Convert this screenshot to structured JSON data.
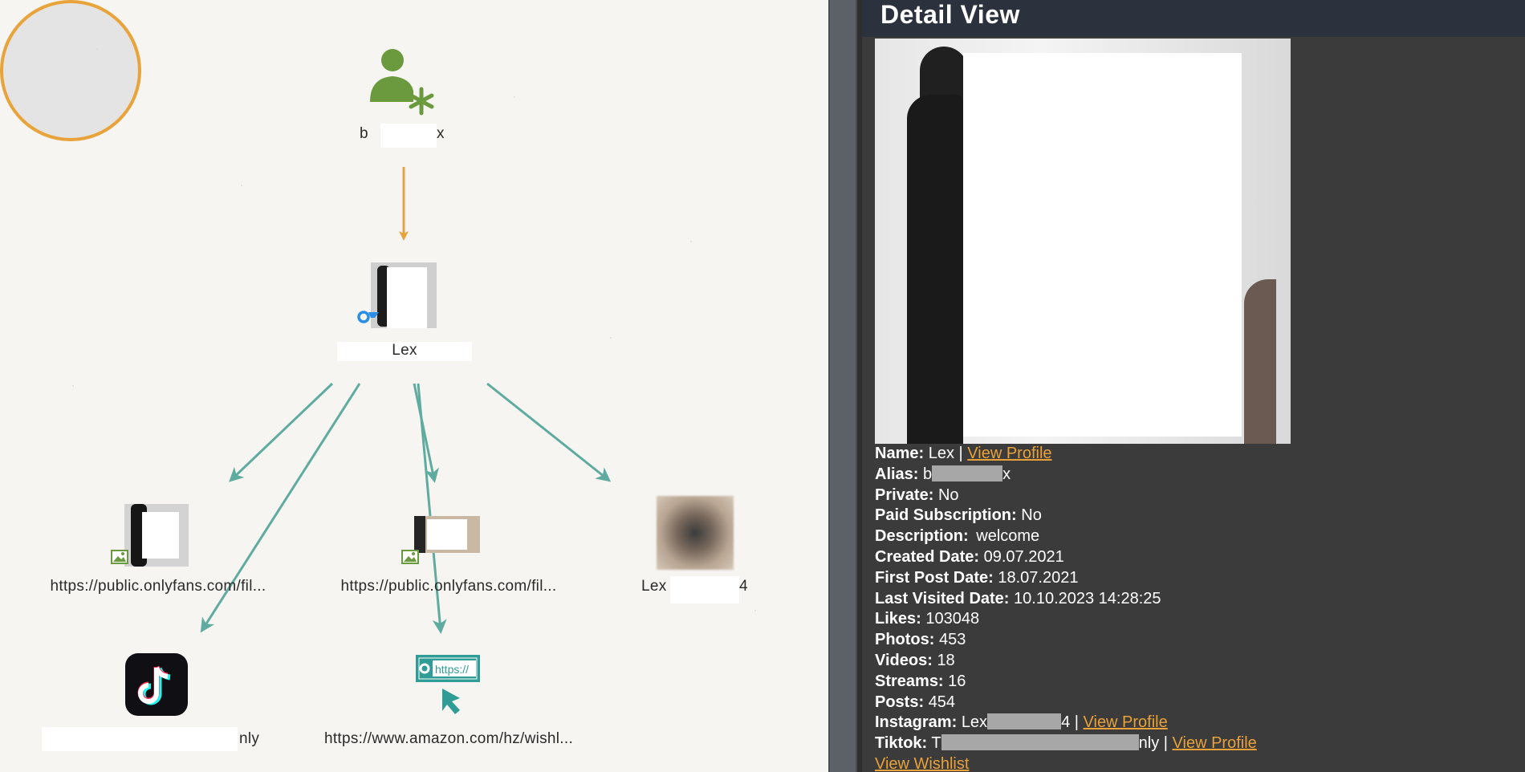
{
  "graph": {
    "alias_node": {
      "icon": "user-add-icon",
      "label_start": "b",
      "label_end": "x",
      "color": "#6b9a3e"
    },
    "center_node": {
      "label": "Lex",
      "badge_icon": "onlyfans-icon",
      "ring_color": "#e8a33a"
    },
    "image_nodes": [
      {
        "label": "https://public.onlyfans.com/fil..."
      },
      {
        "label": "https://public.onlyfans.com/fil..."
      }
    ],
    "instagram_node": {
      "label_start": "Lex",
      "label_end": "4"
    },
    "tiktok_node": {
      "label_end": "nly"
    },
    "wishlist_node": {
      "label": "https://www.amazon.com/hz/wishl...",
      "icon_text": "https://"
    },
    "edge_colors": {
      "primary": "#e8a33a",
      "secondary": "#5fab9f"
    }
  },
  "detail": {
    "title": "Detail View",
    "fields": {
      "name": {
        "key": "Name:",
        "value": "Lex",
        "sep": "|",
        "link": "View Profile"
      },
      "alias": {
        "key": "Alias:",
        "value_start": "b",
        "value_end": "x"
      },
      "private": {
        "key": "Private:",
        "value": "No"
      },
      "paid_subscription": {
        "key": "Paid Subscription:",
        "value": "No"
      },
      "description": {
        "key": "Description:",
        "value": "welcome"
      },
      "created_date": {
        "key": "Created Date:",
        "value": "09.07.2021"
      },
      "first_post_date": {
        "key": "First Post Date:",
        "value": "18.07.2021"
      },
      "last_visited_date": {
        "key": "Last Visited Date:",
        "value": "10.10.2023 14:28:25"
      },
      "likes": {
        "key": "Likes:",
        "value": "103048"
      },
      "photos": {
        "key": "Photos:",
        "value": "453"
      },
      "videos": {
        "key": "Videos:",
        "value": "18"
      },
      "streams": {
        "key": "Streams:",
        "value": "16"
      },
      "posts": {
        "key": "Posts:",
        "value": "454"
      },
      "instagram": {
        "key": "Instagram:",
        "value_start": "Lex",
        "value_end": "4",
        "sep": "|",
        "link": "View Profile"
      },
      "tiktok": {
        "key": "Tiktok:",
        "value_start": "T",
        "value_end": "nly",
        "sep": "|",
        "link": "View Profile"
      },
      "wishlist": {
        "link": "View Wishlist"
      }
    },
    "link_color": "#e9a13a"
  }
}
